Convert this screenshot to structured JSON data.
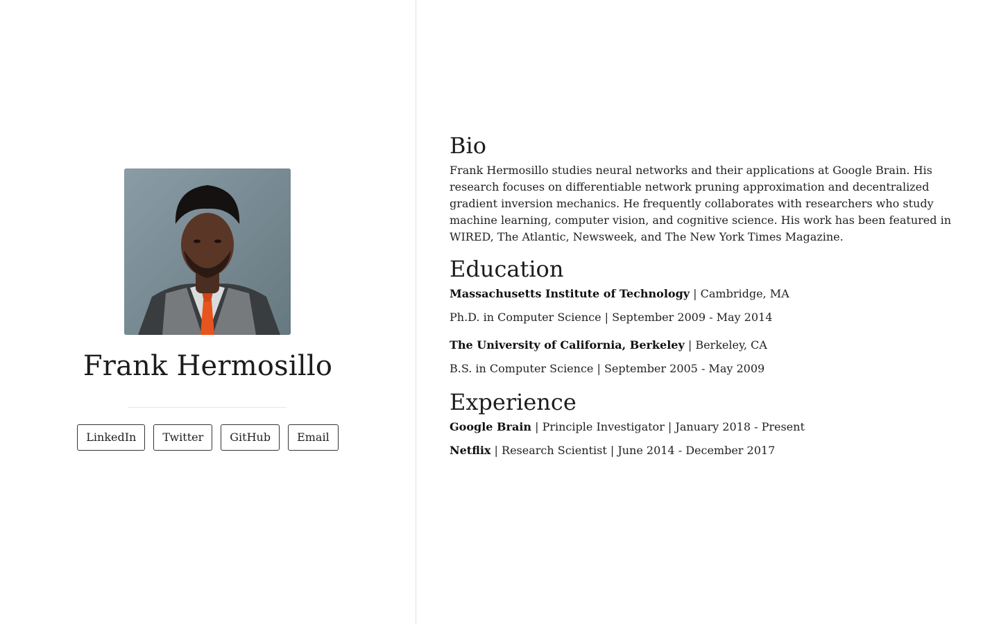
{
  "profile": {
    "name": "Frank Hermosillo",
    "links": [
      "LinkedIn",
      "Twitter",
      "GitHub",
      "Email"
    ]
  },
  "bio": {
    "title": "Bio",
    "text": "Frank Hermosillo studies neural networks and their applications at Google Brain. His research focuses on differentiable network pruning approximation and decentralized gradient inversion mechanics. He frequently collaborates with researchers who study machine learning, computer vision, and cognitive science. His work has been featured in WIRED, The Atlantic, Newsweek, and The New York Times Magazine."
  },
  "education": {
    "title": "Education",
    "entries": [
      {
        "school": "Massachusetts Institute of Technology",
        "location": " | Cambridge, MA",
        "degree": "Ph.D. in Computer Science | September 2009 - May 2014"
      },
      {
        "school": "The University of California, Berkeley",
        "location": " | Berkeley, CA",
        "degree": "B.S. in Computer Science | September 2005 - May 2009"
      }
    ]
  },
  "experience": {
    "title": "Experience",
    "entries": [
      {
        "org": "Google Brain",
        "details": " | Principle Investigator | January 2018 - Present"
      },
      {
        "org": "Netflix",
        "details": " | Research Scientist | June 2014 - December 2017"
      }
    ]
  },
  "colors": {
    "text": "#1f1f1f",
    "divider": "#e2e2e2",
    "button_border": "#333333",
    "tie": "#e8541e"
  }
}
